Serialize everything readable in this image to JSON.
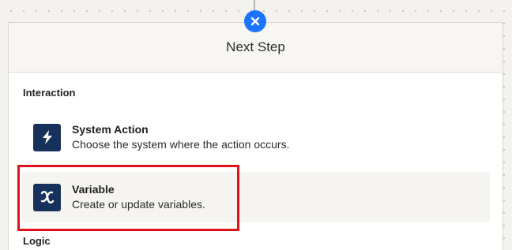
{
  "panel": {
    "title": "Next Step"
  },
  "sections": {
    "interaction": {
      "heading": "Interaction",
      "items": [
        {
          "icon": "lightning-bolt-icon",
          "title": "System Action",
          "description": "Choose the system where the action occurs."
        },
        {
          "icon": "variable-x-icon",
          "title": "Variable",
          "description": "Create or update variables."
        }
      ]
    },
    "logic": {
      "heading": "Logic"
    }
  },
  "colors": {
    "accent": "#1b74ff",
    "icon_background": "#16325c",
    "highlight_outline": "#e0121b",
    "panel_header": "#f7f6f3"
  }
}
